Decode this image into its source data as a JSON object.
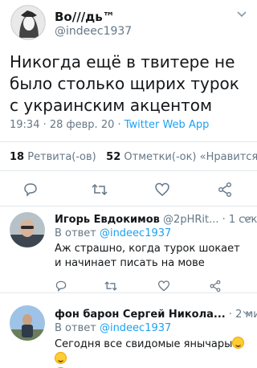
{
  "tweet": {
    "author_name": "Во///дь™",
    "handle": "@indeec1937",
    "text": "Никогда ещё в твитере не было столько щирих турок с украинским акцентом",
    "time_date": "19:34 · 28 февр. 20 · ",
    "source": "Twitter Web App",
    "retweets_count": "18",
    "retweets_label": " Ретвита(-ов)",
    "likes_count": "52",
    "likes_label": " Отметки(-ок) «Нравится»"
  },
  "replies": [
    {
      "author_name": "Игорь Евдокимов",
      "handle": " @2pHRit...",
      "time": " · 1 сек",
      "reply_to_prefix": "В ответ ",
      "reply_to_handle": "@indeec1937",
      "text": "Аж страшно, когда турок шокает и начинает писать на мове"
    },
    {
      "author_name": "фон барон Сергей Никола...",
      "time": " · 2 мин",
      "reply_to_prefix": "В ответ ",
      "reply_to_handle": "@indeec1937",
      "text": "Сегодня все свидомые янычары"
    }
  ],
  "icons": [
    "reply-icon",
    "retweet-icon",
    "like-icon",
    "share-icon",
    "chevron-down-icon"
  ],
  "colors": {
    "accent": "#1da1f2",
    "muted": "#657786",
    "divider": "#e1e8ed",
    "text": "#14171a"
  }
}
